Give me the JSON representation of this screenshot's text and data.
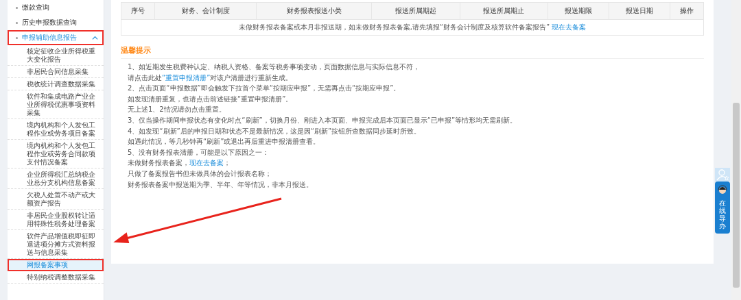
{
  "sidebar": {
    "items": [
      {
        "label": "缴款查询",
        "expanded": false,
        "annotated": false
      },
      {
        "label": "历史申报数据查询",
        "expanded": false,
        "annotated": false
      },
      {
        "label": "申报辅助信息报告",
        "expanded": true,
        "annotated": true,
        "children": [
          {
            "label": "核定征收企业所得税重大变化报告",
            "selected": false,
            "annotated": false
          },
          {
            "label": "非居民合同信息采集",
            "selected": false,
            "annotated": false
          },
          {
            "label": "税收统计调查数据采集",
            "selected": false,
            "annotated": false
          },
          {
            "label": "软件和集成电路产业企业所得税优惠事项资料采集",
            "selected": false,
            "annotated": false
          },
          {
            "label": "境内机构和个人发包工程作业或劳务项目备案",
            "selected": false,
            "annotated": false
          },
          {
            "label": "境内机构和个人发包工程作业或劳务合同款项支付情况备案",
            "selected": false,
            "annotated": false
          },
          {
            "label": "企业所得税汇总纳税企业总分支机构信息备案",
            "selected": false,
            "annotated": false
          },
          {
            "label": "欠税人处置不动产或大额资产报告",
            "selected": false,
            "annotated": false
          },
          {
            "label": "非居民企业股权转让适用特殊性税务处理备案",
            "selected": false,
            "annotated": false
          },
          {
            "label": "软件产品增值税即征即退进项分摊方式资料报送与信息采集",
            "selected": false,
            "annotated": false
          },
          {
            "label": "网报备案事项",
            "selected": true,
            "annotated": true
          },
          {
            "label": "特别纳税调整数据采集",
            "selected": false,
            "annotated": false
          }
        ]
      }
    ]
  },
  "table": {
    "columns": [
      "序号",
      "财务、会计制度",
      "财务报表报送小类",
      "报送所属期起",
      "报送所属期止",
      "报送期限",
      "报送日期",
      "操作"
    ],
    "empty_message": {
      "text": "未做财务报表备案或本月非报送期，如未做财务报表备案,请先填报“财务会计制度及核算软件备案报告”",
      "link": "现在去备案"
    }
  },
  "tips": {
    "title": "温馨提示",
    "lines": [
      [
        {
          "kind": "text",
          "text": "1、如近期发生税费种认定、纳税人资格、备案等税务事项变动，页面数据信息与实际信息不符，"
        }
      ],
      [
        {
          "kind": "text",
          "text": "请点击此处"
        },
        {
          "kind": "link",
          "text": "“重置申报清册”"
        },
        {
          "kind": "text",
          "text": "对该户清册进行重新生成。"
        }
      ],
      [
        {
          "kind": "text",
          "text": "2、点击页面“申报数据”即会触发下拉首个菜单“按期应申报”，无需再点击“按期应申报”。"
        }
      ],
      [
        {
          "kind": "text",
          "text": "如发现清册重复，也请点击前述链接“重置申报清册”。"
        }
      ],
      [
        {
          "kind": "text",
          "text": "无上述1、2情况请勿点击重置。"
        }
      ],
      [
        {
          "kind": "text",
          "text": "3、仅当操作期间申报状态有变化时点“刷新”，切换月份、刚进入本页面、申报完成后本页面已显示“已申报”等情形均无需刷新。"
        }
      ],
      [
        {
          "kind": "text",
          "text": "4、如发现“刷新”后的申报日期和状态不是最新情况，这是因“刷新”按钮所查数据同步延时所致。"
        }
      ],
      [
        {
          "kind": "text",
          "text": "如遇此情况，等几秒钟再“刷新”或退出再后重进申报清册查看。"
        }
      ],
      [
        {
          "kind": "text",
          "text": "5、没有财务报表清册，可能是以下原因之一："
        }
      ],
      [
        {
          "kind": "text",
          "text": "未做财务报表备案，"
        },
        {
          "kind": "link",
          "text": "现在去备案"
        },
        {
          "kind": "text",
          "text": "；"
        }
      ],
      [
        {
          "kind": "text",
          "text": "只做了备案报告书但未做具体的会计报表名称；"
        }
      ],
      [
        {
          "kind": "text",
          "text": "财务报表备案中报送期为季、半年、年等情况，非本月报送。"
        }
      ]
    ]
  },
  "assistant": {
    "label": "在线导办"
  }
}
